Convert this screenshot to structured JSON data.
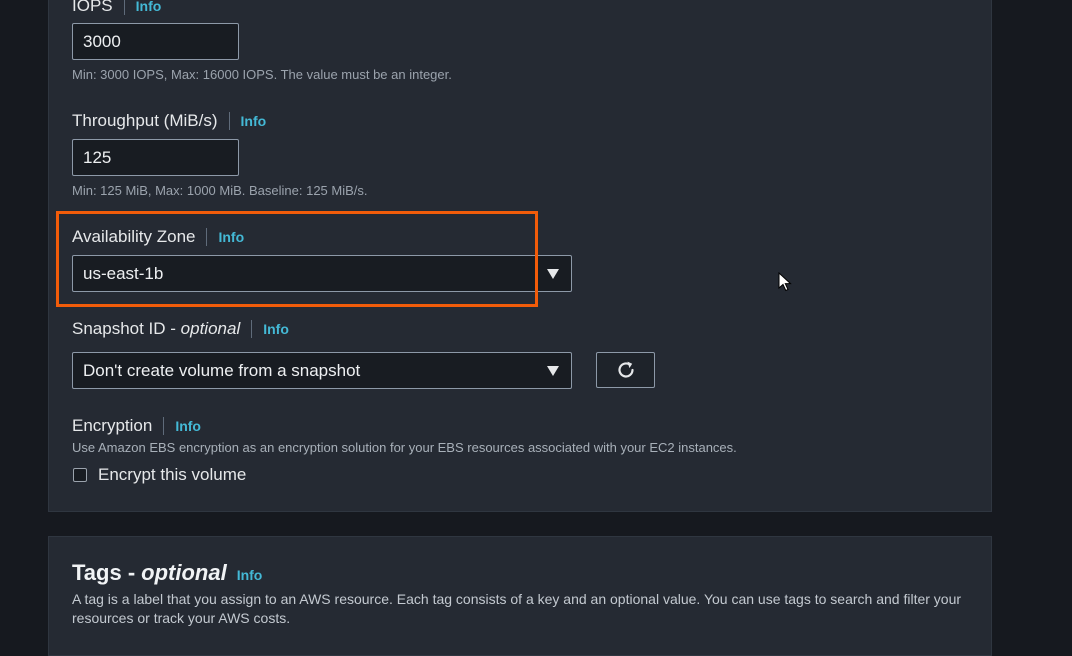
{
  "volume": {
    "iops": {
      "label": "IOPS",
      "info": "Info",
      "value": "3000",
      "hint": "Min: 3000 IOPS, Max: 16000 IOPS. The value must be an integer."
    },
    "throughput": {
      "label": "Throughput (MiB/s)",
      "info": "Info",
      "value": "125",
      "hint": "Min: 125 MiB, Max: 1000 MiB. Baseline: 125 MiB/s."
    },
    "availability_zone": {
      "label": "Availability Zone",
      "info": "Info",
      "selected": "us-east-1b"
    },
    "snapshot": {
      "label": "Snapshot ID - ",
      "optional": "optional",
      "info": "Info",
      "selected": "Don't create volume from a snapshot",
      "refresh_icon": "refresh-icon"
    },
    "encryption": {
      "label": "Encryption",
      "info": "Info",
      "description": "Use Amazon EBS encryption as an encryption solution for your EBS resources associated with your EC2 instances.",
      "checkbox_label": "Encrypt this volume",
      "checked": false
    }
  },
  "tags": {
    "title": "Tags -",
    "optional": "optional",
    "info": "Info",
    "description": "A tag is a label that you assign to an AWS resource. Each tag consists of a key and an optional value. You can use tags to search and filter your resources or track your AWS costs."
  },
  "colors": {
    "highlight": "#f25c0a",
    "info_link": "#44b9d6",
    "background": "#16191f",
    "panel": "#252a33"
  }
}
